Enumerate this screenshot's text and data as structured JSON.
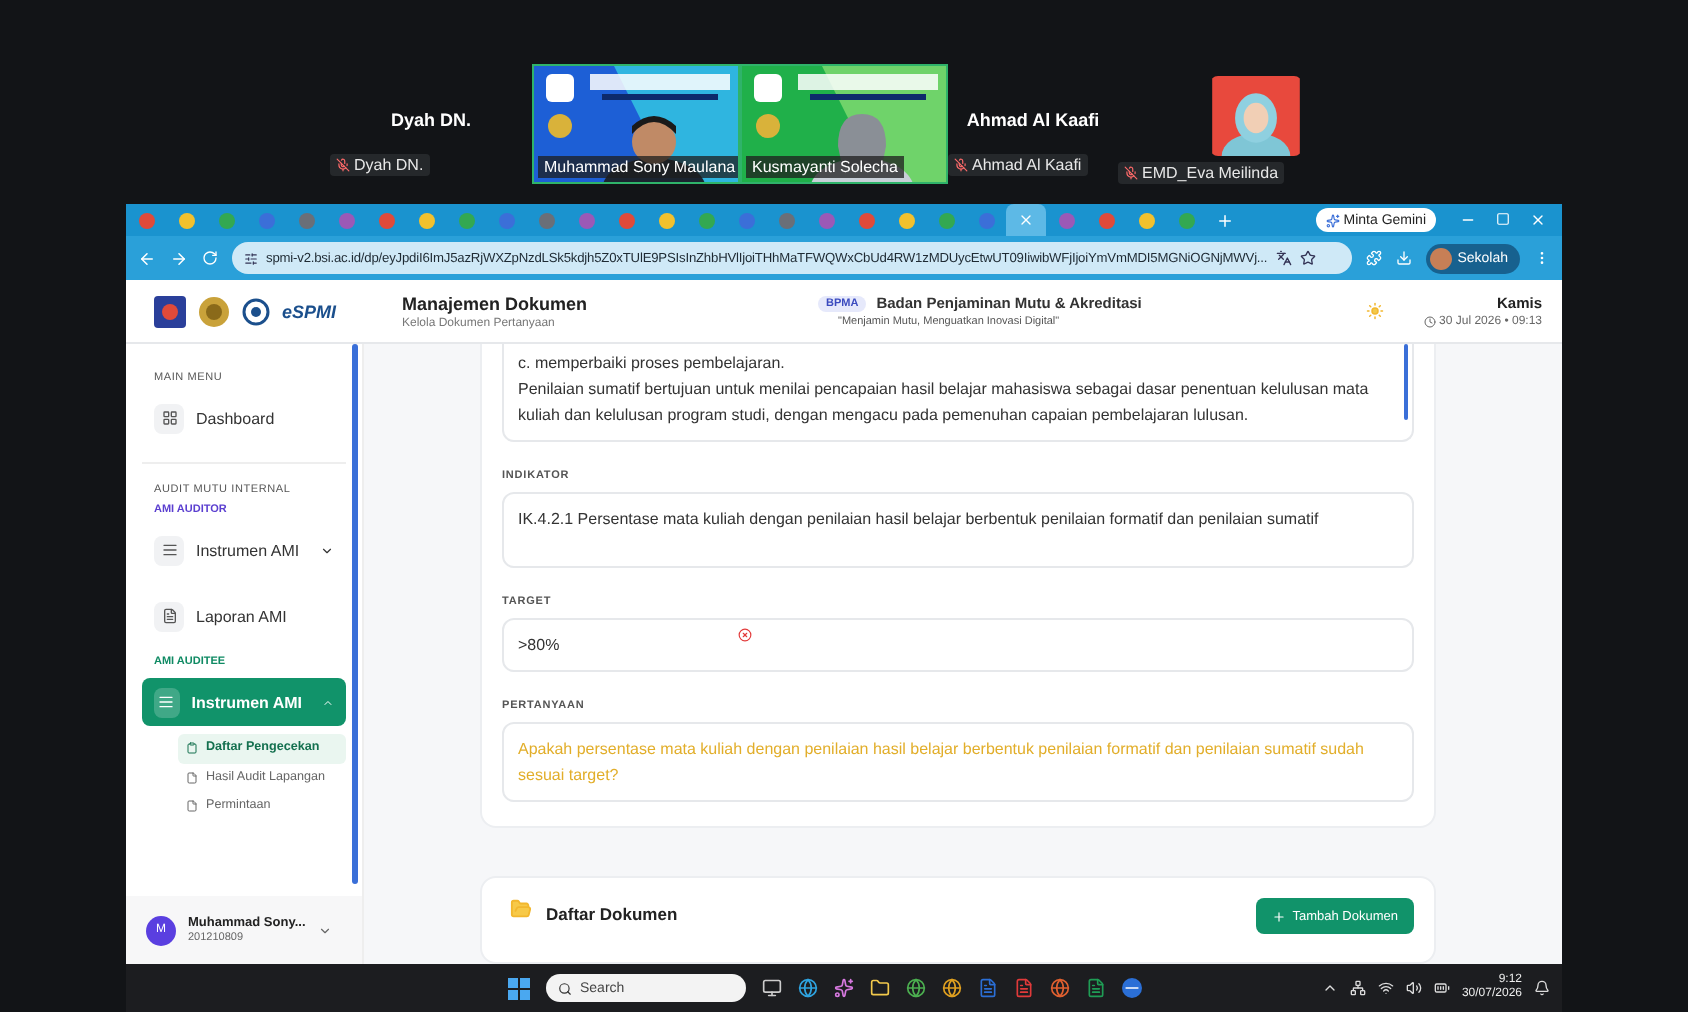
{
  "participants": [
    {
      "kind": "name",
      "name": "Dyah DN.",
      "label": "Dyah DN.",
      "muted": true
    },
    {
      "kind": "video",
      "label": "Muhammad Sony Maulana",
      "muted": false
    },
    {
      "kind": "video",
      "label": "Kusmayanti Solecha",
      "muted": false
    },
    {
      "kind": "name",
      "name": "Ahmad Al Kaafi",
      "label": "Ahmad Al Kaafi",
      "muted": true
    },
    {
      "label": "EMD_Eva Meilinda",
      "muted": true
    }
  ],
  "browser": {
    "tabs": [
      {
        "selected": false
      },
      {
        "selected": false
      },
      {
        "selected": false
      },
      {
        "selected": false
      },
      {
        "selected": false
      },
      {
        "selected": false
      },
      {
        "selected": false
      },
      {
        "selected": false
      },
      {
        "selected": false
      },
      {
        "selected": false
      },
      {
        "selected": false
      },
      {
        "selected": false
      },
      {
        "selected": false
      },
      {
        "selected": false
      },
      {
        "selected": false
      },
      {
        "selected": false
      },
      {
        "selected": false
      },
      {
        "selected": false
      },
      {
        "selected": false
      },
      {
        "selected": false
      },
      {
        "selected": false
      },
      {
        "selected": false
      },
      {
        "selected": true
      },
      {
        "selected": false
      },
      {
        "selected": false
      },
      {
        "selected": false
      },
      {
        "selected": false
      }
    ],
    "gemini_button": "Minta Gemini",
    "url": "spmi-v2.bsi.ac.id/dp/eyJpdiI6ImJ5azRjWXZpNzdLSk5kdjh5Z0xTUlE9PSIsInZhbHVlIjoiTHhMaTFWQWxCbUd4RW1zMDUycEtwUT09IiwibWFjIjoiYmVmMDI5MGNiOGNjMWVj...",
    "profile": "Sekolah"
  },
  "header": {
    "logo_text": "eSPMI",
    "title": "Manajemen Dokumen",
    "subtitle": "Kelola Dokumen Pertanyaan",
    "org_badge": "BPMA",
    "org_name": "Badan Penjaminan Mutu & Akreditasi",
    "tagline": "\"Menjamin Mutu, Menguatkan Inovasi Digital\"",
    "day": "Kamis",
    "date": "30 Jul 2026 • 09:13"
  },
  "sidebar": {
    "items": [
      {
        "kind": "heading",
        "label": "MAIN MENU"
      },
      {
        "kind": "grid",
        "label": "Dashboard",
        "selected": false
      },
      {
        "kind": "divider"
      },
      {
        "kind": "heading",
        "label": "AUDIT MUTU INTERNAL"
      },
      {
        "kind": "group",
        "label": "AMI AUDITOR",
        "color": "#5b3fd0"
      },
      {
        "kind": "menu",
        "label": "Instrumen AMI",
        "selected": false,
        "expanded": false
      },
      {
        "kind": "document",
        "label": "Laporan AMI",
        "selected": false
      },
      {
        "kind": "group",
        "label": "AMI AUDITEE",
        "color": "#0f8a63"
      },
      {
        "kind": "menu",
        "label": "Instrumen AMI",
        "selected": true,
        "expanded": true,
        "children": [
          {
            "label": "Daftar Pengecekan",
            "selected": true
          },
          {
            "label": "Hasil Audit Lapangan",
            "selected": false
          },
          {
            "label": "Permintaan",
            "selected": false
          }
        ]
      }
    ],
    "user": {
      "initial": "M",
      "name": "Muhammad Sony...",
      "id": "201210809"
    }
  },
  "form": {
    "fields": [
      {
        "kind": "textarea",
        "lines": [
          "c. memperbaiki proses pembelajaran.",
          "Penilaian sumatif bertujuan untuk menilai pencapaian hasil belajar mahasiswa sebagai dasar penentuan kelulusan mata",
          "kuliah dan kelulusan program studi, dengan mengacu pada pemenuhan capaian pembelajaran lulusan."
        ],
        "highlighted": false
      },
      {
        "kind": "textarea",
        "label": "INDIKATOR",
        "lines": [
          "IK.4.2.1 Persentase mata kuliah dengan penilaian hasil belajar berbentuk penilaian formatif dan penilaian sumatif"
        ],
        "highlighted": false
      },
      {
        "kind": "input",
        "label": "TARGET",
        "lines": [
          ">80%"
        ],
        "highlighted": false
      },
      {
        "kind": "textarea",
        "label": "PERTANYAAN",
        "lines": [
          "Apakah persentase mata kuliah dengan penilaian hasil belajar berbentuk penilaian formatif dan penilaian sumatif sudah sesuai target?"
        ],
        "highlighted": true
      }
    ]
  },
  "documents": {
    "title": "Daftar Dokumen",
    "add_button": "Tambah Dokumen"
  },
  "taskbar": {
    "search_placeholder": "Search",
    "time": "9:12",
    "date": "30/07/2026"
  }
}
